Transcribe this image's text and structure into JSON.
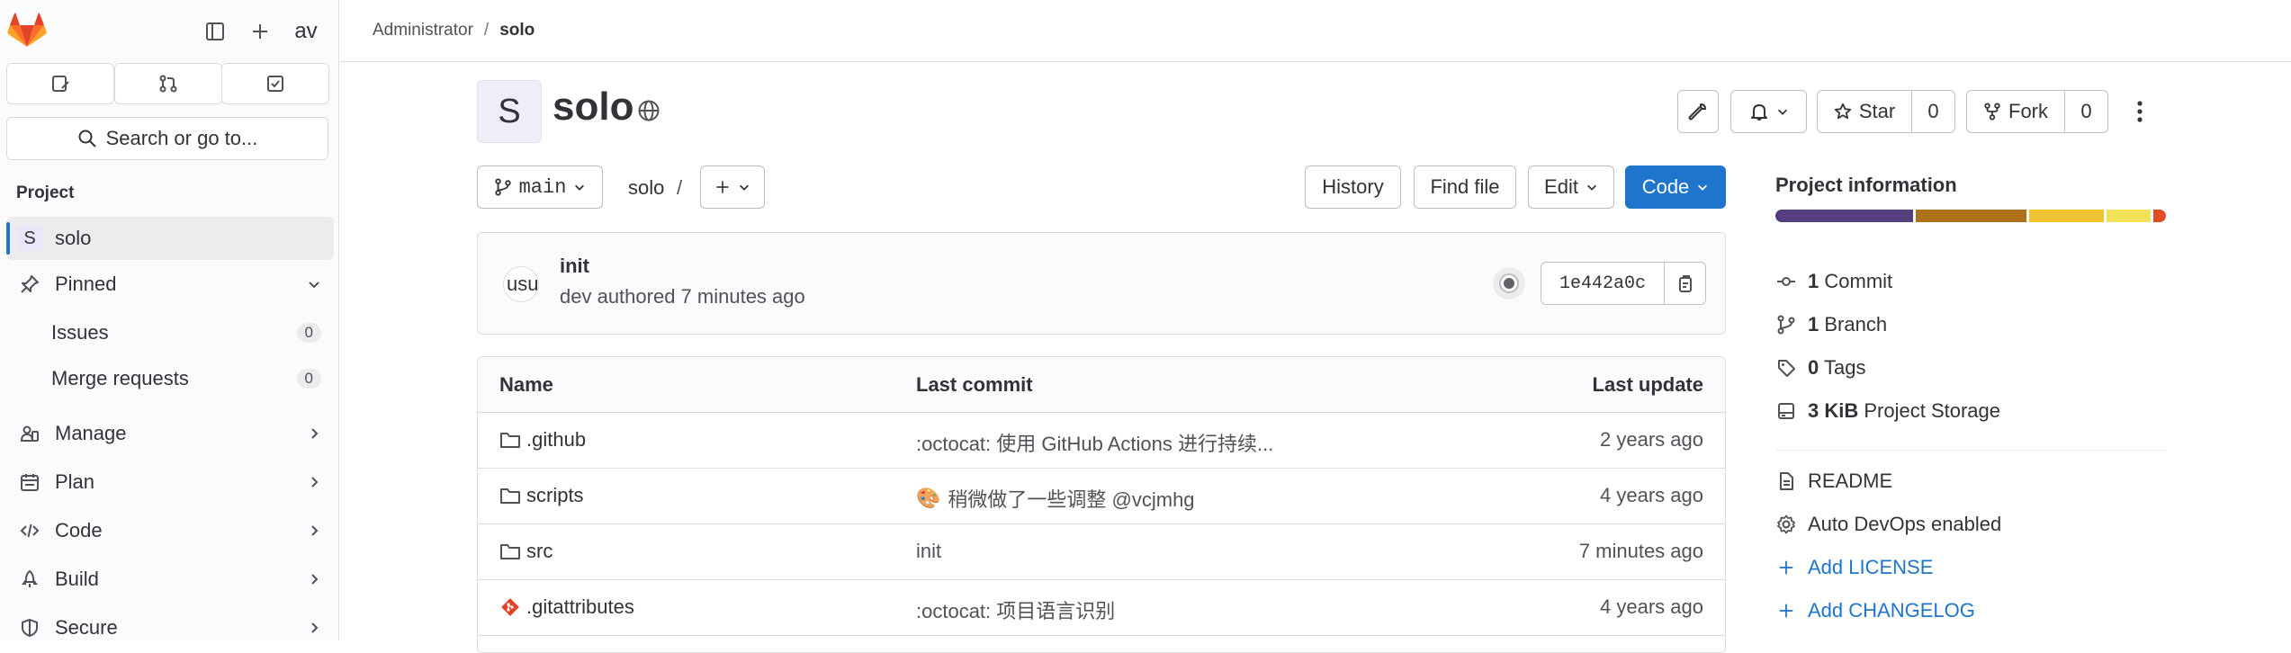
{
  "sidebar": {
    "avatar_text": "av",
    "search_label": "Search or go to...",
    "section_label": "Project",
    "project": {
      "badge": "S",
      "label": "solo"
    },
    "pinned_label": "Pinned",
    "pinned_items": [
      {
        "label": "Issues",
        "count": "0"
      },
      {
        "label": "Merge requests",
        "count": "0"
      }
    ],
    "nav_items": [
      {
        "label": "Manage",
        "icon": "users-icon"
      },
      {
        "label": "Plan",
        "icon": "planning-icon"
      },
      {
        "label": "Code",
        "icon": "code-icon"
      },
      {
        "label": "Build",
        "icon": "rocket-icon"
      },
      {
        "label": "Secure",
        "icon": "shield-icon"
      }
    ]
  },
  "breadcrumb": {
    "parent": "Administrator",
    "separator": "/",
    "current": "solo"
  },
  "project": {
    "avatar": "S",
    "title": "solo"
  },
  "header_actions": {
    "star_label": "Star",
    "star_count": "0",
    "fork_label": "Fork",
    "fork_count": "0"
  },
  "repo_nav": {
    "branch": "main",
    "path": "solo",
    "path_sep": "/",
    "history": "History",
    "find_file": "Find file",
    "edit": "Edit",
    "code": "Code"
  },
  "last_commit": {
    "avatar_text": "usu",
    "title": "init",
    "meta": "dev authored 7 minutes ago",
    "sha": "1e442a0c"
  },
  "files": {
    "headers": {
      "name": "Name",
      "last_commit": "Last commit",
      "last_update": "Last update"
    },
    "rows": [
      {
        "name": ".github",
        "type": "folder",
        "message": ":octocat: 使用 GitHub Actions 进行持续...",
        "updated": "2 years ago"
      },
      {
        "name": "scripts",
        "type": "folder",
        "message": "稍微做了一些调整 @vcjmhg",
        "emoji": "🎨",
        "updated": "4 years ago"
      },
      {
        "name": "src",
        "type": "folder",
        "message": "init",
        "updated": "7 minutes ago"
      },
      {
        "name": ".gitattributes",
        "type": "git-file",
        "message": ":octocat: 项目语言识别",
        "updated": "4 years ago"
      }
    ]
  },
  "project_info": {
    "title": "Project information",
    "languages": [
      {
        "color": "#563d7c",
        "percent": 22
      },
      {
        "color": "#b07219",
        "percent": 17.5
      },
      {
        "color": "#f1c232",
        "percent": 12
      },
      {
        "color": "#f1e05a",
        "percent": 7
      },
      {
        "color": "#e34c26",
        "percent": 2
      }
    ],
    "stats": [
      {
        "value": "1",
        "label": "Commit",
        "icon": "commit-icon"
      },
      {
        "value": "1",
        "label": "Branch",
        "icon": "branch-icon"
      },
      {
        "value": "0",
        "label": "Tags",
        "icon": "label-icon"
      },
      {
        "value": "3 KiB",
        "label": "Project Storage",
        "icon": "disk-icon"
      }
    ],
    "links": [
      {
        "label": "README",
        "icon": "document-icon",
        "link": false
      },
      {
        "label": "Auto DevOps enabled",
        "icon": "gear-icon",
        "link": false
      },
      {
        "label": "Add LICENSE",
        "icon": "plus-icon",
        "link": true
      },
      {
        "label": "Add CHANGELOG",
        "icon": "plus-icon",
        "link": true
      }
    ]
  }
}
